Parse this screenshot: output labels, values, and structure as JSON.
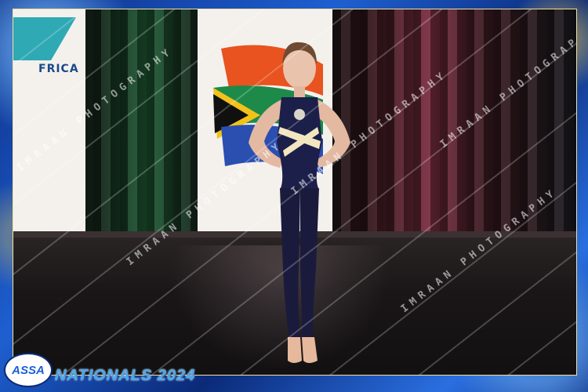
{
  "banner": {
    "left_text": "FRICA"
  },
  "watermark": {
    "text": "IMRAAN PHOTOGRAPHY"
  },
  "logo": {
    "text": "ASSA"
  },
  "event": {
    "title": "NATIONALS 2024"
  },
  "colors": {
    "frame_blue": "#1e5fd0",
    "title_blue": "#4aa8e8",
    "costume_navy": "#1c1f4a",
    "costume_stripe": "#f2e6c0"
  }
}
